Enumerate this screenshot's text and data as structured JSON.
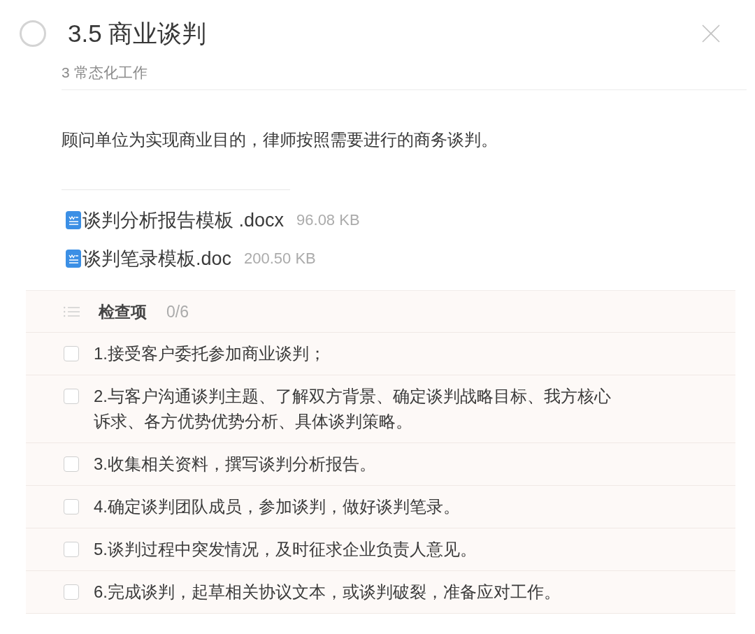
{
  "task": {
    "done": false,
    "title": "3.5 商业谈判",
    "parent": "3 常态化工作",
    "description": "顾问单位为实现商业目的，律师按照需要进行的商务谈判。",
    "attachments": [
      {
        "name": "谈判分析报告模板 .docx",
        "size": "96.08 KB"
      },
      {
        "name": "谈判笔录模板.doc",
        "size": "200.50 KB"
      }
    ],
    "checklist": {
      "title": "检查项",
      "progress": "0/6",
      "items": [
        {
          "text": "1.接受客户委托参加商业谈判；",
          "checked": false
        },
        {
          "text": "2.与客户沟通谈判主题、了解双方背景、确定谈判战略目标、我方核心诉求、各方优势优势分析、具体谈判策略。",
          "checked": false
        },
        {
          "text": "3.收集相关资料，撰写谈判分析报告。",
          "checked": false
        },
        {
          "text": "4.确定谈判团队成员，参加谈判，做好谈判笔录。",
          "checked": false
        },
        {
          "text": "5.谈判过程中突发情况，及时征求企业负责人意见。",
          "checked": false
        },
        {
          "text": "6.完成谈判，起草相关协议文本，或谈判破裂，准备应对工作。",
          "checked": false
        }
      ]
    }
  }
}
